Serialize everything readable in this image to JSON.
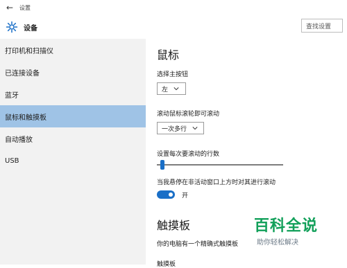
{
  "window": {
    "title": "设置",
    "back_icon": "left-arrow-icon"
  },
  "header": {
    "title": "设备",
    "search_placeholder": "查找设置"
  },
  "sidebar": {
    "items": [
      {
        "label": "打印机和扫描仪"
      },
      {
        "label": "已连接设备"
      },
      {
        "label": "蓝牙"
      },
      {
        "label": "鼠标和触摸板",
        "active": true
      },
      {
        "label": "自动播放"
      },
      {
        "label": "USB"
      }
    ]
  },
  "main": {
    "section_mouse": "鼠标",
    "primary_button": {
      "label": "选择主按钮",
      "value": "左"
    },
    "wheel_scroll": {
      "label": "滚动鼠标滚轮即可滚动",
      "value": "一次多行"
    },
    "lines_to_scroll": {
      "label": "设置每次要滚动的行数",
      "value_fraction": 0.03
    },
    "inactive_scroll": {
      "label": "当我悬停在非活动窗口上方时对其进行滚动",
      "toggle_state": "on",
      "toggle_label": "开"
    },
    "section_touchpad": "触摸板",
    "touchpad_desc": "你的电脑有一个精确式触摸板",
    "touchpad_next": "触摸板"
  },
  "watermark": {
    "title": "百科全说",
    "subtitle": "助你轻松解决"
  },
  "colors": {
    "accent": "#1a6fc7",
    "active_item": "#9fc3e6",
    "sidebar_bg": "#f2f2f2",
    "watermark_green": "#12a05a"
  }
}
